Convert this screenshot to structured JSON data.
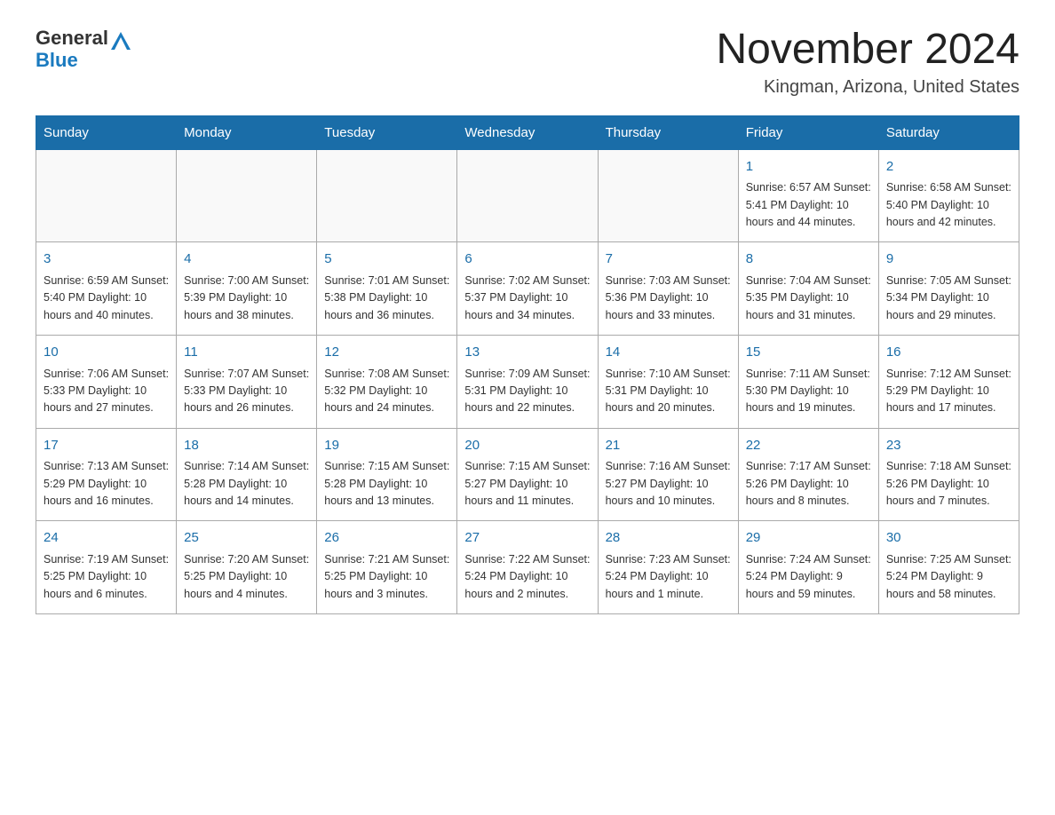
{
  "header": {
    "logo": {
      "general": "General",
      "blue": "Blue"
    },
    "title": "November 2024",
    "location": "Kingman, Arizona, United States"
  },
  "calendar": {
    "days_of_week": [
      "Sunday",
      "Monday",
      "Tuesday",
      "Wednesday",
      "Thursday",
      "Friday",
      "Saturday"
    ],
    "weeks": [
      [
        {
          "day": "",
          "info": ""
        },
        {
          "day": "",
          "info": ""
        },
        {
          "day": "",
          "info": ""
        },
        {
          "day": "",
          "info": ""
        },
        {
          "day": "",
          "info": ""
        },
        {
          "day": "1",
          "info": "Sunrise: 6:57 AM\nSunset: 5:41 PM\nDaylight: 10 hours\nand 44 minutes."
        },
        {
          "day": "2",
          "info": "Sunrise: 6:58 AM\nSunset: 5:40 PM\nDaylight: 10 hours\nand 42 minutes."
        }
      ],
      [
        {
          "day": "3",
          "info": "Sunrise: 6:59 AM\nSunset: 5:40 PM\nDaylight: 10 hours\nand 40 minutes."
        },
        {
          "day": "4",
          "info": "Sunrise: 7:00 AM\nSunset: 5:39 PM\nDaylight: 10 hours\nand 38 minutes."
        },
        {
          "day": "5",
          "info": "Sunrise: 7:01 AM\nSunset: 5:38 PM\nDaylight: 10 hours\nand 36 minutes."
        },
        {
          "day": "6",
          "info": "Sunrise: 7:02 AM\nSunset: 5:37 PM\nDaylight: 10 hours\nand 34 minutes."
        },
        {
          "day": "7",
          "info": "Sunrise: 7:03 AM\nSunset: 5:36 PM\nDaylight: 10 hours\nand 33 minutes."
        },
        {
          "day": "8",
          "info": "Sunrise: 7:04 AM\nSunset: 5:35 PM\nDaylight: 10 hours\nand 31 minutes."
        },
        {
          "day": "9",
          "info": "Sunrise: 7:05 AM\nSunset: 5:34 PM\nDaylight: 10 hours\nand 29 minutes."
        }
      ],
      [
        {
          "day": "10",
          "info": "Sunrise: 7:06 AM\nSunset: 5:33 PM\nDaylight: 10 hours\nand 27 minutes."
        },
        {
          "day": "11",
          "info": "Sunrise: 7:07 AM\nSunset: 5:33 PM\nDaylight: 10 hours\nand 26 minutes."
        },
        {
          "day": "12",
          "info": "Sunrise: 7:08 AM\nSunset: 5:32 PM\nDaylight: 10 hours\nand 24 minutes."
        },
        {
          "day": "13",
          "info": "Sunrise: 7:09 AM\nSunset: 5:31 PM\nDaylight: 10 hours\nand 22 minutes."
        },
        {
          "day": "14",
          "info": "Sunrise: 7:10 AM\nSunset: 5:31 PM\nDaylight: 10 hours\nand 20 minutes."
        },
        {
          "day": "15",
          "info": "Sunrise: 7:11 AM\nSunset: 5:30 PM\nDaylight: 10 hours\nand 19 minutes."
        },
        {
          "day": "16",
          "info": "Sunrise: 7:12 AM\nSunset: 5:29 PM\nDaylight: 10 hours\nand 17 minutes."
        }
      ],
      [
        {
          "day": "17",
          "info": "Sunrise: 7:13 AM\nSunset: 5:29 PM\nDaylight: 10 hours\nand 16 minutes."
        },
        {
          "day": "18",
          "info": "Sunrise: 7:14 AM\nSunset: 5:28 PM\nDaylight: 10 hours\nand 14 minutes."
        },
        {
          "day": "19",
          "info": "Sunrise: 7:15 AM\nSunset: 5:28 PM\nDaylight: 10 hours\nand 13 minutes."
        },
        {
          "day": "20",
          "info": "Sunrise: 7:15 AM\nSunset: 5:27 PM\nDaylight: 10 hours\nand 11 minutes."
        },
        {
          "day": "21",
          "info": "Sunrise: 7:16 AM\nSunset: 5:27 PM\nDaylight: 10 hours\nand 10 minutes."
        },
        {
          "day": "22",
          "info": "Sunrise: 7:17 AM\nSunset: 5:26 PM\nDaylight: 10 hours\nand 8 minutes."
        },
        {
          "day": "23",
          "info": "Sunrise: 7:18 AM\nSunset: 5:26 PM\nDaylight: 10 hours\nand 7 minutes."
        }
      ],
      [
        {
          "day": "24",
          "info": "Sunrise: 7:19 AM\nSunset: 5:25 PM\nDaylight: 10 hours\nand 6 minutes."
        },
        {
          "day": "25",
          "info": "Sunrise: 7:20 AM\nSunset: 5:25 PM\nDaylight: 10 hours\nand 4 minutes."
        },
        {
          "day": "26",
          "info": "Sunrise: 7:21 AM\nSunset: 5:25 PM\nDaylight: 10 hours\nand 3 minutes."
        },
        {
          "day": "27",
          "info": "Sunrise: 7:22 AM\nSunset: 5:24 PM\nDaylight: 10 hours\nand 2 minutes."
        },
        {
          "day": "28",
          "info": "Sunrise: 7:23 AM\nSunset: 5:24 PM\nDaylight: 10 hours\nand 1 minute."
        },
        {
          "day": "29",
          "info": "Sunrise: 7:24 AM\nSunset: 5:24 PM\nDaylight: 9 hours\nand 59 minutes."
        },
        {
          "day": "30",
          "info": "Sunrise: 7:25 AM\nSunset: 5:24 PM\nDaylight: 9 hours\nand 58 minutes."
        }
      ]
    ]
  }
}
